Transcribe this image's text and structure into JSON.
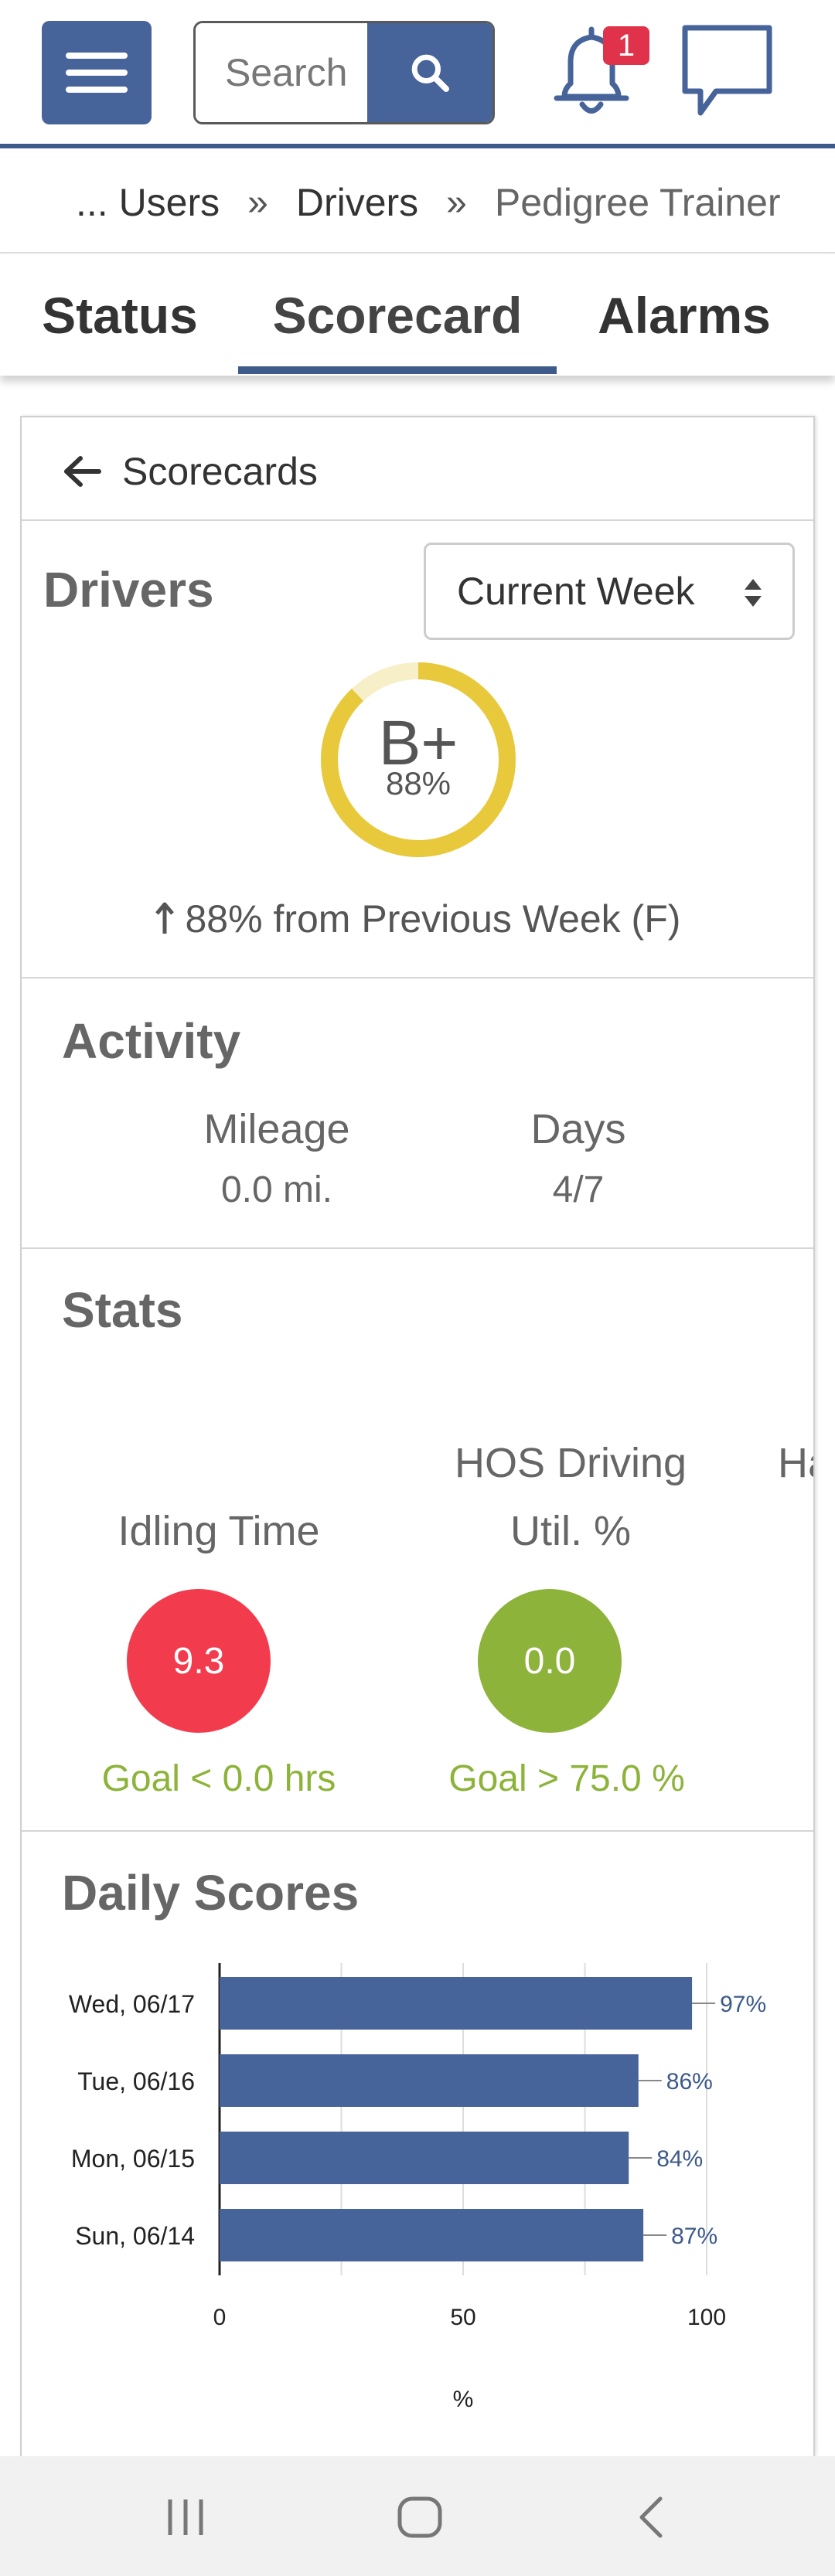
{
  "header": {
    "search_placeholder": "Search",
    "notification_count": "1"
  },
  "breadcrumb": {
    "items": [
      "... Users",
      "Drivers",
      "Pedigree Trainer"
    ]
  },
  "tabs": [
    {
      "label": "Status"
    },
    {
      "label": "Scorecard"
    },
    {
      "label": "Alarms"
    }
  ],
  "card": {
    "back_label": "Scorecards",
    "drivers_title": "Drivers",
    "period_select": "Current Week",
    "grade": "B+",
    "score_pct": "88%",
    "score_fraction": 0.88,
    "trend_text": "88% from Previous Week (F)",
    "activity": {
      "title": "Activity",
      "mileage_label": "Mileage",
      "mileage_value": "0.0 mi.",
      "days_label": "Days",
      "days_value": "4/7"
    },
    "stats": {
      "title": "Stats",
      "items": [
        {
          "label": "Idling Time",
          "value": "9.3",
          "goal": "Goal < 0.0 hrs",
          "color": "#f23c4e"
        },
        {
          "label_line1": "HOS Driving",
          "label_line2": "Util. %",
          "value": "0.0",
          "goal": "Goal > 75.0 %",
          "color": "#8db33a"
        }
      ],
      "partial_label": "Ha"
    },
    "daily": {
      "title": "Daily Scores"
    }
  },
  "chart_data": {
    "type": "bar",
    "orientation": "horizontal",
    "categories": [
      "Wed, 06/17",
      "Tue, 06/16",
      "Mon, 06/15",
      "Sun, 06/14"
    ],
    "values": [
      97,
      86,
      84,
      87
    ],
    "value_labels": [
      "97%",
      "86%",
      "84%",
      "87%"
    ],
    "xticks": [
      "0",
      "50",
      "100"
    ],
    "xlim": [
      0,
      100
    ],
    "xlabel": "%",
    "bar_color": "#46639a"
  },
  "colors": {
    "brand": "#46639a",
    "donut": "#e8c93c",
    "donut_track": "#f7efc8",
    "good": "#8db33a",
    "bad": "#f23c4e"
  }
}
